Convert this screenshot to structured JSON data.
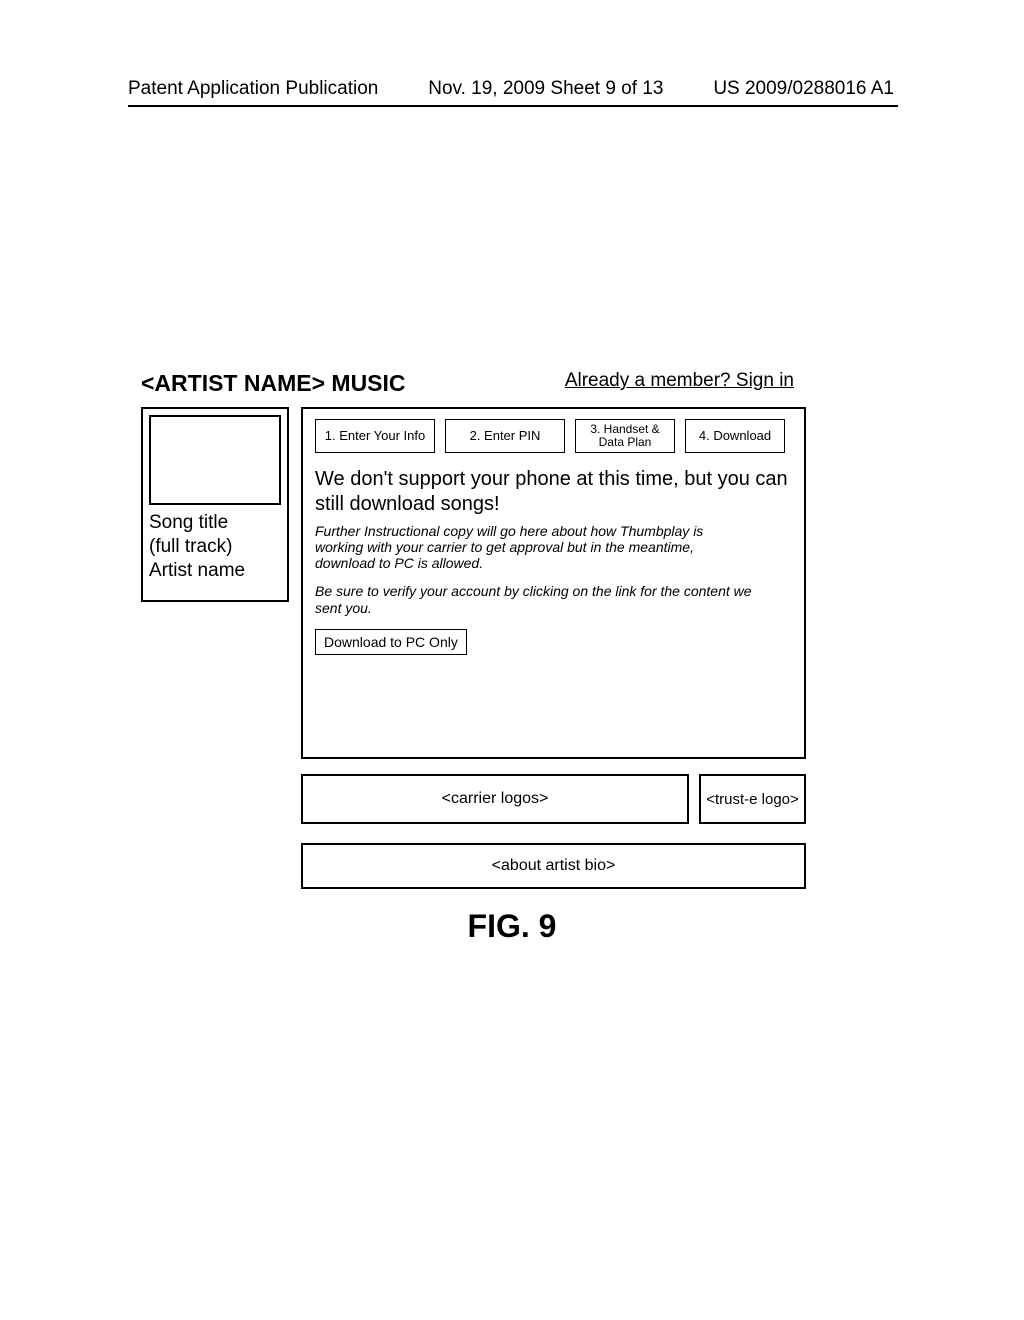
{
  "header": {
    "pub_type": "Patent Application Publication",
    "date_sheet": "Nov. 19, 2009   Sheet 9 of 13",
    "pub_number": "US 2009/0288016 A1"
  },
  "title": "<ARTIST NAME> MUSIC",
  "signin": "Already a member? Sign in",
  "song": {
    "line1": "Song title",
    "line2": "(full track)",
    "line3": "Artist name"
  },
  "steps": {
    "s1": "1. Enter Your Info",
    "s2": "2. Enter PIN",
    "s3": "3. Handset & Data Plan",
    "s4": "4. Download"
  },
  "content": {
    "heading": "We don't support your phone at this time, but you can still download songs!",
    "instructional": "Further Instructional copy will go here about how Thumbplay is working with your carrier to get approval but in the meantime, download to PC is allowed.",
    "verify": "Be sure to verify your account by clicking on the link for the content we sent you.",
    "button": "Download to PC Only"
  },
  "footer": {
    "carrier": "<carrier logos>",
    "truste": "<trust-e logo>",
    "bio": "<about artist bio>"
  },
  "figure_label": "FIG. 9"
}
